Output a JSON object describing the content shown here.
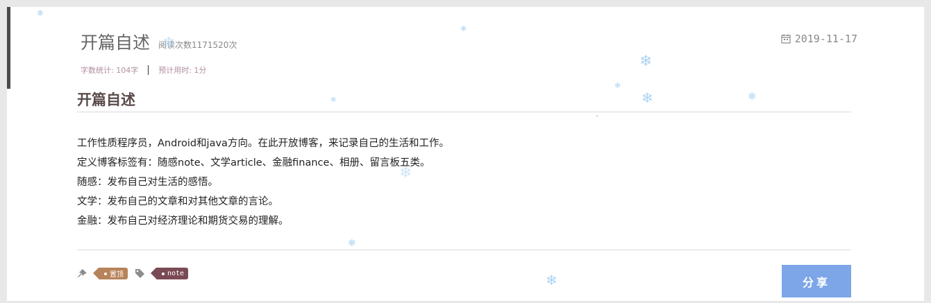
{
  "post": {
    "title": "开篇自述",
    "read_count": "阅读次数1171520次",
    "date": "2019-11-17",
    "word_count": "字数统计: 104字",
    "read_time": "预计用时: 1分",
    "heading": "开篇自述",
    "body": [
      "工作性质程序员，Android和java方向。在此开放博客，来记录自己的生活和工作。",
      "定义博客标签有：随感note、文学article、金融finance、相册、留言板五类。",
      "随感：发布自己对生活的感悟。",
      "文学：发布自己的文章和对其他文章的言论。",
      "金融：发布自己对经济理论和期货交易的理解。"
    ]
  },
  "tags": {
    "pinned_label": "置顶",
    "note_label": "note"
  },
  "share": {
    "label": "分享"
  },
  "icons": {
    "calendar": "calendar-icon",
    "pin": "pin-icon",
    "tag": "tag-icon",
    "snowflake": "snowflake-icon"
  },
  "colors": {
    "accent_bar": "#4a4a4a",
    "share_button": "#7ca6e8",
    "pinned_tag": "#b7835a",
    "note_tag": "#7a4a55",
    "meta_text": "#b08ea0",
    "snowflake": "#a9d3f2"
  },
  "snowflake_glyph": "❄"
}
